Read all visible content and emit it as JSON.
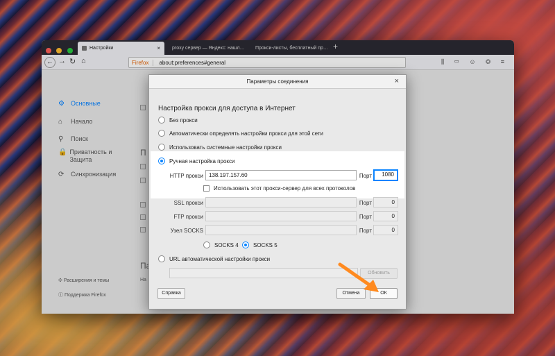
{
  "browser": {
    "tabs": [
      {
        "label": "Настройки",
        "active": true
      },
      {
        "label": "proxy сервер — Яндекс: нашл…",
        "active": false
      },
      {
        "label": "Прокси-листы, бесплатный пр…",
        "active": false
      }
    ],
    "new_tab": "+",
    "url_brand": "Firefox",
    "url": "about:preferences#general",
    "colors": {
      "close": "#ff5f57",
      "minimize": "#febc2e",
      "maximize": "#28c840"
    }
  },
  "sidebar": {
    "items": [
      {
        "label": "Основные",
        "icon": "gear-icon",
        "glyph": "⚙",
        "active": true
      },
      {
        "label": "Начало",
        "icon": "home-icon",
        "glyph": "⌂"
      },
      {
        "label": "Поиск",
        "icon": "search-icon",
        "glyph": "⚲"
      },
      {
        "label": "Приватность и Защита",
        "icon": "lock-icon",
        "glyph": "🔒"
      },
      {
        "label": "Синхронизация",
        "icon": "sync-icon",
        "glyph": "⟳"
      }
    ],
    "bottom": [
      {
        "label": "Расширения и темы",
        "icon": "puzzle-icon",
        "glyph": "✣"
      },
      {
        "label": "Поддержка Firefox",
        "icon": "help-icon",
        "glyph": "ⓘ"
      }
    ]
  },
  "background_fragments": {
    "p1": "П",
    "p2": "П",
    "na": "Па",
    "nar": "На"
  },
  "dialog": {
    "title": "Параметры соединения",
    "close": "×",
    "heading": "Настройка прокси для доступа в Интернет",
    "options": {
      "no_proxy": "Без прокси",
      "auto_detect": "Автоматически определять настройки прокси для этой сети",
      "system": "Использовать системные настройки прокси",
      "manual": "Ручная настройка прокси",
      "auto_url": "URL автоматической настройки прокси"
    },
    "selected": "manual",
    "http": {
      "label": "HTTP прокси",
      "value": "138.197.157.60",
      "port_label": "Порт",
      "port": "1080"
    },
    "use_for_all": "Использовать этот прокси-сервер для всех протоколов",
    "ssl": {
      "label": "SSL прокси",
      "value": "",
      "port_label": "Порт",
      "port": "0"
    },
    "ftp": {
      "label": "FTP прокси",
      "value": "",
      "port_label": "Порт",
      "port": "0"
    },
    "socks": {
      "label": "Узел SOCKS",
      "value": "",
      "port_label": "Порт",
      "port": "0"
    },
    "socks4": "SOCKS 4",
    "socks5": "SOCKS 5",
    "socks_selected": "SOCKS 5",
    "auto_url_value": "",
    "reload": "Обновить",
    "help": "Справка",
    "cancel": "Отмена",
    "ok": "ОК"
  },
  "annotation": {
    "color": "#ff8a1f",
    "icon": "arrow-pointer-icon"
  }
}
